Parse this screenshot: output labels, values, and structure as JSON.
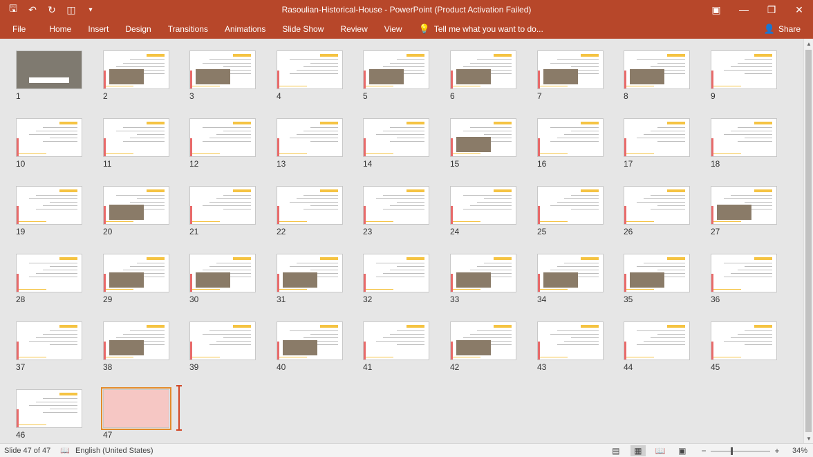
{
  "window": {
    "title": "Rasoulian-Historical-House  -  PowerPoint (Product Activation Failed)"
  },
  "qat": {
    "save_icon": "save-icon",
    "undo_icon": "undo-icon",
    "redo_icon": "redo-icon",
    "present_icon": "start-from-beginning-icon",
    "customize_icon": "customize-qat-icon"
  },
  "ribbon": {
    "tabs": [
      "File",
      "Home",
      "Insert",
      "Design",
      "Transitions",
      "Animations",
      "Slide Show",
      "Review",
      "View"
    ],
    "tell_me": "Tell me what you want to do...",
    "share": "Share"
  },
  "slides": {
    "count": 47,
    "selected": 47,
    "numbers": [
      "1",
      "2",
      "3",
      "4",
      "5",
      "6",
      "7",
      "8",
      "9",
      "10",
      "11",
      "12",
      "13",
      "14",
      "15",
      "16",
      "17",
      "18",
      "19",
      "20",
      "21",
      "22",
      "23",
      "24",
      "25",
      "26",
      "27",
      "28",
      "29",
      "30",
      "31",
      "32",
      "33",
      "34",
      "35",
      "36",
      "37",
      "38",
      "39",
      "40",
      "41",
      "42",
      "43",
      "44",
      "45",
      "46",
      "47"
    ]
  },
  "status": {
    "slide_info": "Slide 47 of 47",
    "language": "English (United States)",
    "zoom": "34%",
    "zoom_fraction": 0.34
  },
  "colors": {
    "accent": "#b7472a",
    "selection": "#e38b2a"
  }
}
